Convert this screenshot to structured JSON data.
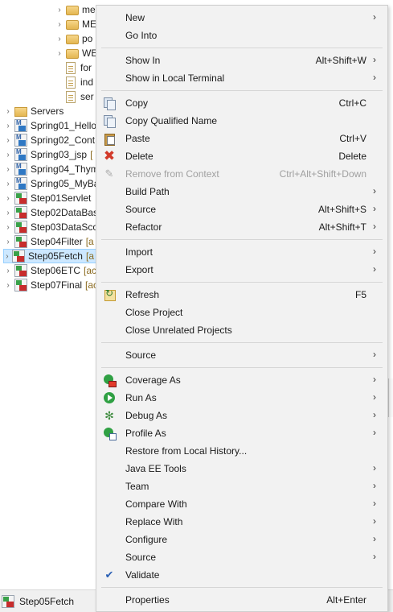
{
  "explorer": {
    "rows": [
      {
        "label": "me",
        "icon": "folder-icon",
        "indent": 1
      },
      {
        "label": "ME",
        "icon": "folder-icon",
        "indent": 1
      },
      {
        "label": "po",
        "icon": "folder-icon",
        "indent": 1
      },
      {
        "label": "WE",
        "icon": "folder-icon",
        "indent": 1
      },
      {
        "label": "for",
        "icon": "file-icon",
        "indent": 2
      },
      {
        "label": "ind",
        "icon": "file-icon",
        "indent": 2
      },
      {
        "label": "ser",
        "icon": "file-icon",
        "indent": 2
      },
      {
        "label": "Servers",
        "icon": "servers-folder-icon",
        "indent": 0
      },
      {
        "label": "Spring01_Hello",
        "icon": "maven-project-icon",
        "indent": 0
      },
      {
        "label": "Spring02_Cont",
        "icon": "maven-project-icon",
        "indent": 0
      },
      {
        "label": "Spring03_jsp",
        "decor": "[",
        "icon": "maven-project-icon",
        "indent": 0
      },
      {
        "label": "Spring04_Thym",
        "icon": "maven-project-icon",
        "indent": 0
      },
      {
        "label": "Spring05_MyBa",
        "icon": "maven-project-icon",
        "indent": 0
      },
      {
        "label": "Step01Servlet",
        "icon": "web-project-icon",
        "indent": 0
      },
      {
        "label": "Step02DataBas",
        "icon": "web-project-icon",
        "indent": 0
      },
      {
        "label": "Step03DataSco",
        "icon": "web-project-icon",
        "indent": 0
      },
      {
        "label": "Step04Filter",
        "decor": "[a",
        "icon": "web-project-icon",
        "indent": 0
      },
      {
        "label": "Step05Fetch",
        "decor": "[a",
        "icon": "web-project-icon",
        "indent": 0,
        "selected": true
      },
      {
        "label": "Step06ETC",
        "decor": "[ac",
        "icon": "web-project-icon",
        "indent": 0
      },
      {
        "label": "Step07Final",
        "decor": "[ac",
        "icon": "web-project-icon",
        "indent": 0
      }
    ]
  },
  "status_bar": {
    "label": "Step05Fetch"
  },
  "menu": {
    "items": [
      {
        "id": "new",
        "label": "New",
        "shortcut": "",
        "submenu": true,
        "icon": ""
      },
      {
        "id": "go-into",
        "label": "Go Into",
        "shortcut": "",
        "submenu": false,
        "icon": ""
      },
      {
        "sep": true
      },
      {
        "id": "show-in",
        "label": "Show In",
        "shortcut": "Alt+Shift+W",
        "submenu": true,
        "icon": ""
      },
      {
        "id": "show-in-local-terminal",
        "label": "Show in Local Terminal",
        "shortcut": "",
        "submenu": true,
        "icon": ""
      },
      {
        "sep": true
      },
      {
        "id": "copy",
        "label": "Copy",
        "shortcut": "Ctrl+C",
        "submenu": false,
        "icon": "copy-icon"
      },
      {
        "id": "copy-qualified-name",
        "label": "Copy Qualified Name",
        "shortcut": "",
        "submenu": false,
        "icon": "copy-icon"
      },
      {
        "id": "paste",
        "label": "Paste",
        "shortcut": "Ctrl+V",
        "submenu": false,
        "icon": "paste-icon"
      },
      {
        "id": "delete",
        "label": "Delete",
        "shortcut": "Delete",
        "submenu": false,
        "icon": "delete-icon"
      },
      {
        "id": "remove-from-context",
        "label": "Remove from Context",
        "shortcut": "Ctrl+Alt+Shift+Down",
        "submenu": false,
        "icon": "remove-context-icon",
        "disabled": true
      },
      {
        "id": "build-path",
        "label": "Build Path",
        "shortcut": "",
        "submenu": true,
        "icon": ""
      },
      {
        "id": "source-1",
        "label": "Source",
        "shortcut": "Alt+Shift+S",
        "submenu": true,
        "icon": ""
      },
      {
        "id": "refactor",
        "label": "Refactor",
        "shortcut": "Alt+Shift+T",
        "submenu": true,
        "icon": ""
      },
      {
        "sep": true
      },
      {
        "id": "import",
        "label": "Import",
        "shortcut": "",
        "submenu": true,
        "icon": ""
      },
      {
        "id": "export",
        "label": "Export",
        "shortcut": "",
        "submenu": true,
        "icon": ""
      },
      {
        "sep": true
      },
      {
        "id": "refresh",
        "label": "Refresh",
        "shortcut": "F5",
        "submenu": false,
        "icon": "refresh-icon"
      },
      {
        "id": "close-project",
        "label": "Close Project",
        "shortcut": "",
        "submenu": false,
        "icon": ""
      },
      {
        "id": "close-unrelated-projects",
        "label": "Close Unrelated Projects",
        "shortcut": "",
        "submenu": false,
        "icon": ""
      },
      {
        "sep": true
      },
      {
        "id": "source-2",
        "label": "Source",
        "shortcut": "",
        "submenu": true,
        "icon": ""
      },
      {
        "sep": true
      },
      {
        "id": "coverage-as",
        "label": "Coverage As",
        "shortcut": "",
        "submenu": true,
        "icon": "coverage-icon"
      },
      {
        "id": "run-as",
        "label": "Run As",
        "shortcut": "",
        "submenu": true,
        "icon": "run-icon"
      },
      {
        "id": "debug-as",
        "label": "Debug As",
        "shortcut": "",
        "submenu": true,
        "icon": "debug-icon"
      },
      {
        "id": "profile-as",
        "label": "Profile As",
        "shortcut": "",
        "submenu": true,
        "icon": "profile-icon"
      },
      {
        "id": "restore-from-local-history",
        "label": "Restore from Local History...",
        "shortcut": "",
        "submenu": false,
        "icon": ""
      },
      {
        "id": "java-ee-tools",
        "label": "Java EE Tools",
        "shortcut": "",
        "submenu": true,
        "icon": ""
      },
      {
        "id": "team",
        "label": "Team",
        "shortcut": "",
        "submenu": true,
        "icon": ""
      },
      {
        "id": "compare-with",
        "label": "Compare With",
        "shortcut": "",
        "submenu": true,
        "icon": ""
      },
      {
        "id": "replace-with",
        "label": "Replace With",
        "shortcut": "",
        "submenu": true,
        "icon": ""
      },
      {
        "id": "configure",
        "label": "Configure",
        "shortcut": "",
        "submenu": true,
        "icon": ""
      },
      {
        "id": "source-3",
        "label": "Source",
        "shortcut": "",
        "submenu": true,
        "icon": ""
      },
      {
        "id": "validate",
        "label": "Validate",
        "shortcut": "",
        "submenu": false,
        "icon": "checkmark-icon"
      },
      {
        "sep": true
      },
      {
        "id": "properties",
        "label": "Properties",
        "shortcut": "Alt+Enter",
        "submenu": false,
        "icon": ""
      }
    ]
  }
}
